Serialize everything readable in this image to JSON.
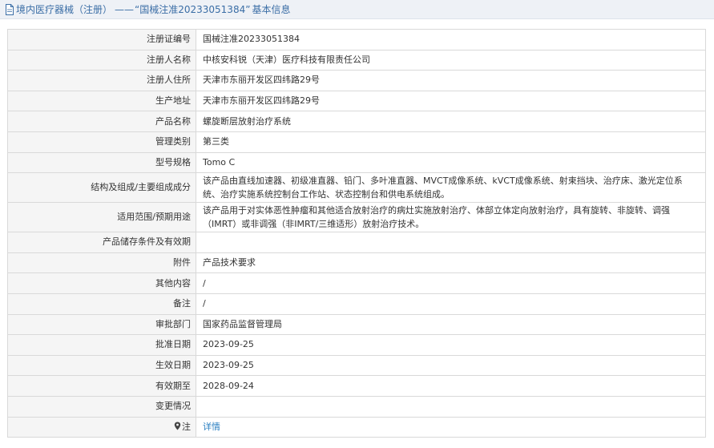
{
  "header": {
    "category": "境内医疗器械（注册）",
    "separator": "——",
    "registration_title": "“国械注准20233051384”",
    "suffix": "基本信息"
  },
  "rows": [
    {
      "label": "注册证编号",
      "value": "国械注准20233051384"
    },
    {
      "label": "注册人名称",
      "value": "中核安科锐（天津）医疗科技有限责任公司"
    },
    {
      "label": "注册人住所",
      "value": "天津市东丽开发区四纬路29号"
    },
    {
      "label": "生产地址",
      "value": "天津市东丽开发区四纬路29号"
    },
    {
      "label": "产品名称",
      "value": "螺旋断层放射治疗系统"
    },
    {
      "label": "管理类别",
      "value": "第三类"
    },
    {
      "label": "型号规格",
      "value": "Tomo C"
    },
    {
      "label": "结构及组成/主要组成成分",
      "value": "该产品由直线加速器、初级准直器、铅门、多叶准直器、MVCT成像系统、kVCT成像系统、射束挡块、治疗床、激光定位系统、治疗实施系统控制台工作站、状态控制台和供电系统组成。"
    },
    {
      "label": "适用范围/预期用途",
      "value": "该产品用于对实体恶性肿瘤和其他适合放射治疗的病灶实施放射治疗、体部立体定向放射治疗，具有旋转、非旋转、调强（IMRT）或非调强（非IMRT/三维适形）放射治疗技术。"
    },
    {
      "label": "产品储存条件及有效期",
      "value": ""
    },
    {
      "label": "附件",
      "value": "产品技术要求"
    },
    {
      "label": "其他内容",
      "value": "/"
    },
    {
      "label": "备注",
      "value": "/"
    },
    {
      "label": "审批部门",
      "value": "国家药品监督管理局"
    },
    {
      "label": "批准日期",
      "value": "2023-09-25"
    },
    {
      "label": "生效日期",
      "value": "2023-09-25"
    },
    {
      "label": "有效期至",
      "value": "2028-09-24"
    },
    {
      "label": "变更情况",
      "value": ""
    }
  ],
  "note": {
    "label": "注",
    "link_text": "详情"
  },
  "colors": {
    "header_text": "#3b6ea6",
    "label_bg": "#f5f5f5",
    "border": "#d9d9d9",
    "link": "#2a7fc1"
  }
}
